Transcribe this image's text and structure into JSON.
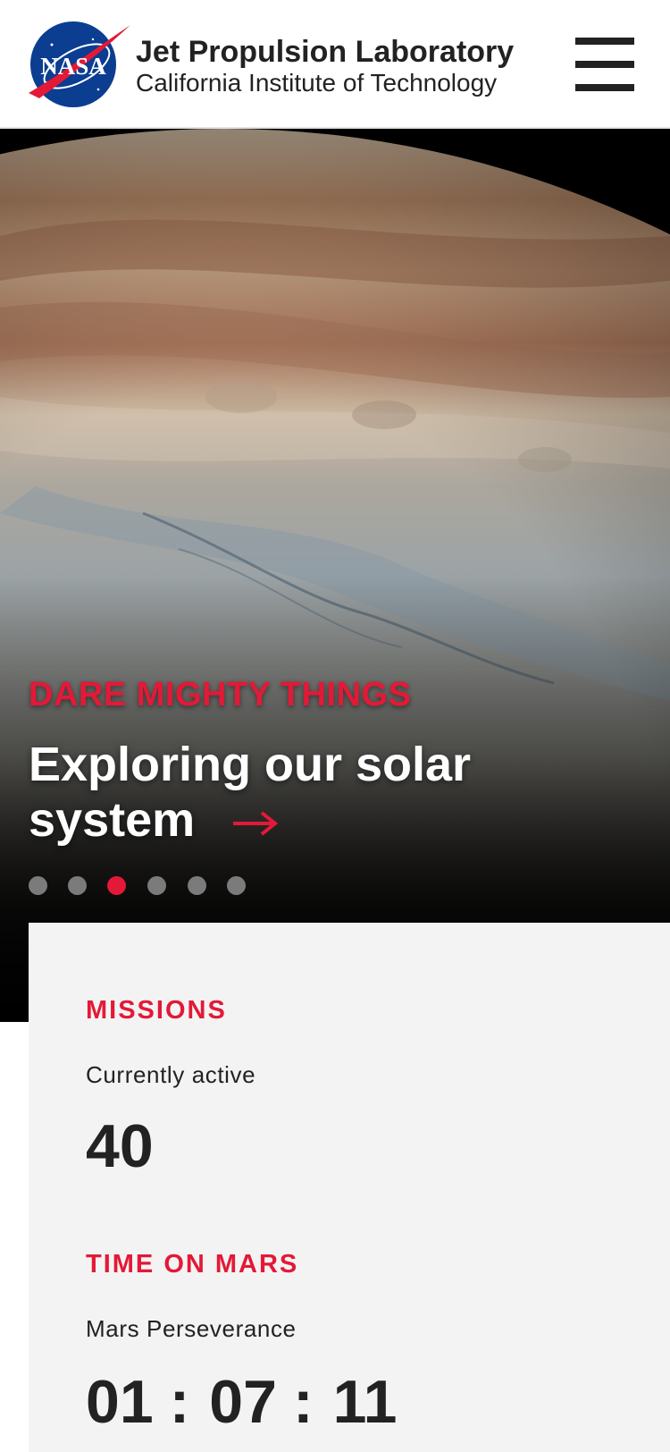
{
  "header": {
    "logo_text": "NASA",
    "title": "Jet Propulsion Laboratory",
    "subtitle": "California Institute of Technology",
    "menu_icon": "hamburger-menu-icon"
  },
  "hero": {
    "eyebrow": "DARE MIGHTY THINGS",
    "headline": "Exploring our solar system",
    "arrow_icon": "arrow-right-icon",
    "slides_total": 6,
    "active_slide": 3
  },
  "stats": {
    "missions": {
      "label": "MISSIONS",
      "sublabel": "Currently active",
      "value": "40"
    },
    "mars_time": {
      "label": "TIME ON MARS",
      "sublabel": "Mars Perseverance",
      "hours": "01",
      "minutes": "07",
      "seconds": "11",
      "separator": ":"
    }
  },
  "colors": {
    "accent": "#e31937",
    "text": "#222222",
    "panel": "#f3f3f3"
  }
}
